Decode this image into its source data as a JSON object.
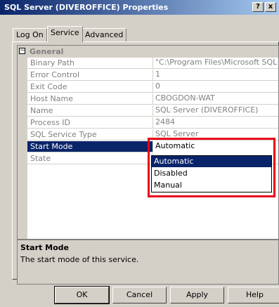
{
  "window": {
    "title": "SQL Server (DIVEROFFICE) Properties",
    "help_glyph": "?",
    "close_glyph": "x"
  },
  "tabs": [
    {
      "label": "Log On",
      "active": false
    },
    {
      "label": "Service",
      "active": true
    },
    {
      "label": "Advanced",
      "active": false
    }
  ],
  "grid": {
    "category": {
      "label": "General",
      "toggle": "⊟"
    },
    "properties": [
      {
        "name": "Binary Path",
        "value": "\"C:\\Program Files\\Microsoft SQL Ser"
      },
      {
        "name": "Error Control",
        "value": "1"
      },
      {
        "name": "Exit Code",
        "value": "0"
      },
      {
        "name": "Host Name",
        "value": "CBOGDON-WAT"
      },
      {
        "name": "Name",
        "value": "SQL Server (DIVEROFFICE)"
      },
      {
        "name": "Process ID",
        "value": "2484"
      },
      {
        "name": "SQL Service Type",
        "value": "SQL Server"
      },
      {
        "name": "Start Mode",
        "value": "Automatic"
      },
      {
        "name": "State",
        "value": ""
      }
    ],
    "combo_arrow": "▼"
  },
  "dropdown": {
    "options": [
      "Automatic",
      "Disabled",
      "Manual"
    ],
    "highlighted": "Automatic"
  },
  "help": {
    "title": "Start Mode",
    "description": "The start mode of this service."
  },
  "buttons": {
    "ok": "OK",
    "cancel": "Cancel",
    "apply": "Apply",
    "help": "Help"
  }
}
